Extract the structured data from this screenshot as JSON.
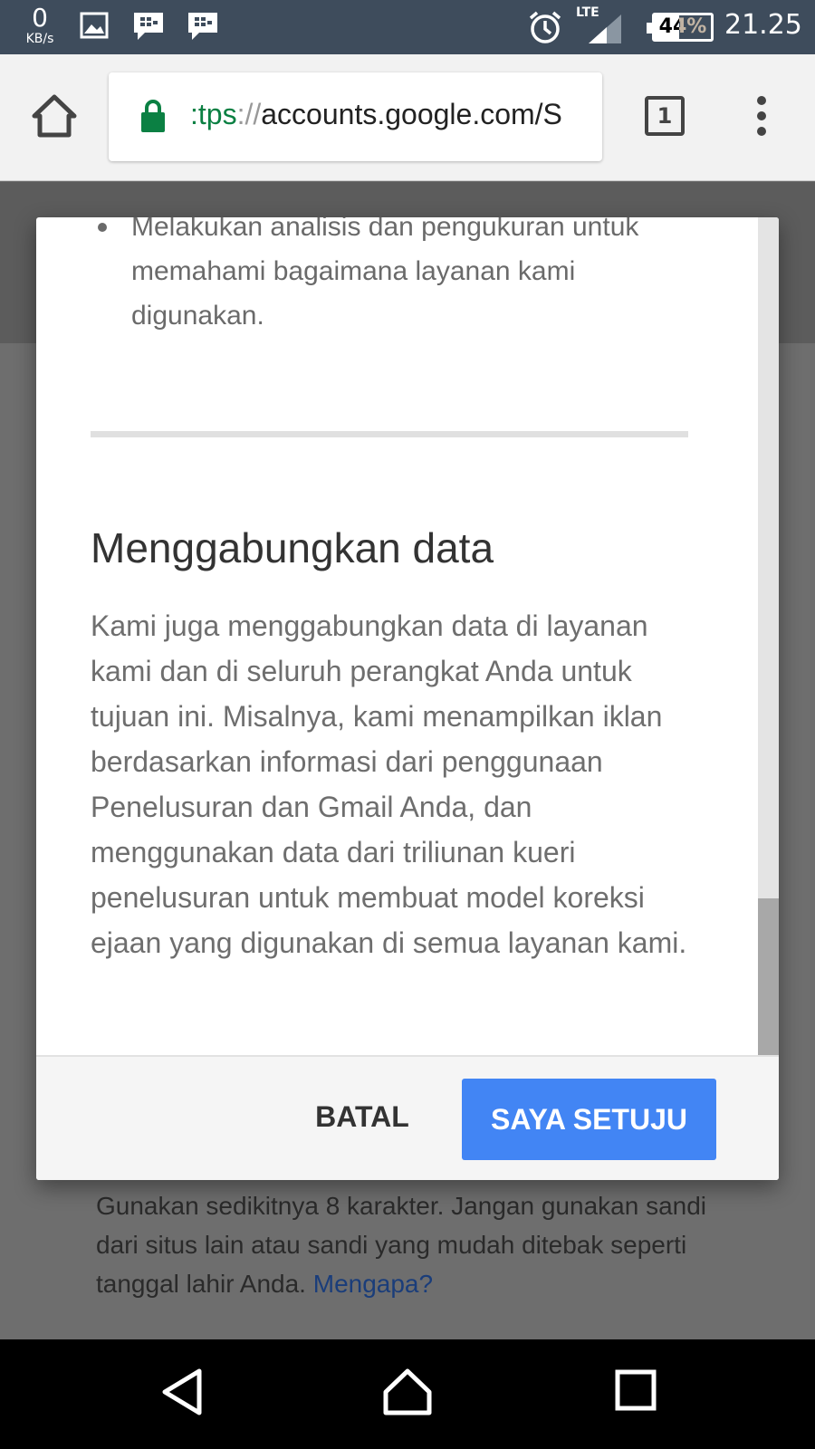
{
  "status_bar": {
    "speed_value": "0",
    "speed_unit": "KB/s",
    "network": "LTE",
    "battery_level": 0.44,
    "battery": "44%",
    "time": "21.25",
    "icons": [
      "gallery-icon",
      "bbm-icon",
      "bbm-icon",
      "alarm-icon",
      "signal-icon",
      "battery-icon"
    ]
  },
  "toolbar": {
    "url_scheme": ":tps",
    "url_sep": "://",
    "url_host": "accounts.google.com/S",
    "tab_count": "1",
    "secure_color": "#0b8043"
  },
  "dialog": {
    "bullet_text": "Melakukan analisis dan pengukuran untuk memahami bagaimana layanan kami digunakan.",
    "section_title": "Menggabungkan data",
    "section_body": "Kami juga menggabungkan data di layanan kami dan di seluruh perangkat Anda untuk tujuan ini. Misalnya, kami menampilkan iklan berdasarkan informasi dari penggunaan Penelusuran dan Gmail Anda, dan menggunakan data dari triliunan kueri penelusuran untuk membuat model koreksi ejaan yang digunakan di semua layanan kami.",
    "cancel_label": "BATAL",
    "agree_label": "SAYA SETUJU",
    "accent_color": "#4285f4"
  },
  "background_page": {
    "hint_text": "Gunakan sedikitnya 8 karakter. Jangan gunakan sandi dari situs lain atau sandi yang mudah ditebak seperti tanggal lahir Anda.",
    "hint_link": "Mengapa?"
  }
}
